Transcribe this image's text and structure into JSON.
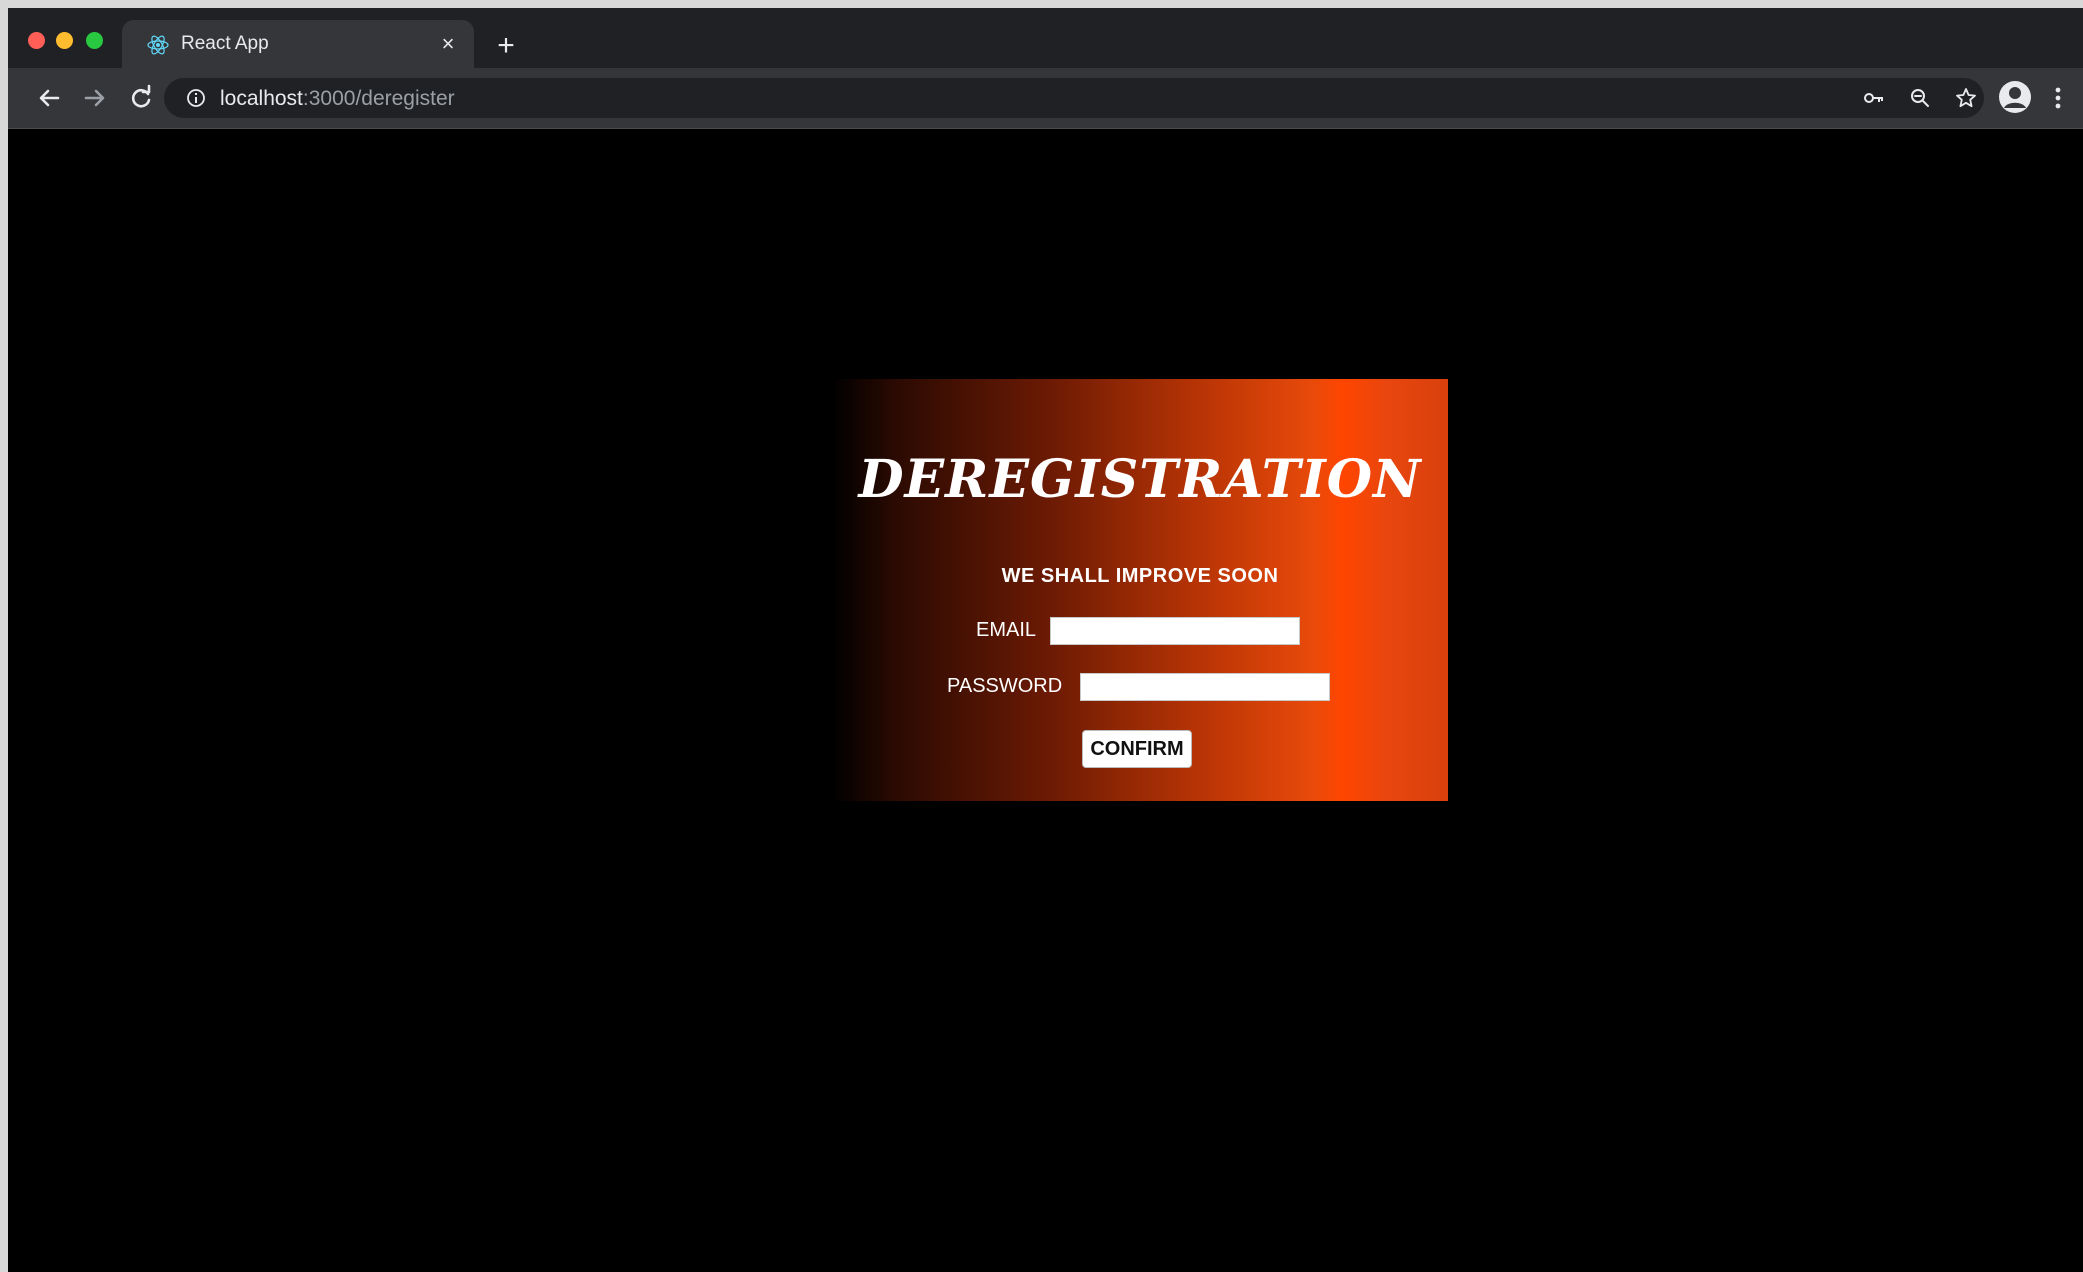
{
  "browser": {
    "tab": {
      "title": "React App",
      "close_glyph": "×",
      "favicon": "react-icon"
    },
    "new_tab_glyph": "+",
    "url": {
      "host": "localhost",
      "path": ":3000/deregister"
    },
    "toolbar_icons": [
      "back-arrow-icon",
      "forward-arrow-icon",
      "reload-icon",
      "info-icon",
      "key-icon",
      "zoom-icon",
      "star-icon",
      "profile-icon",
      "menu-icon"
    ]
  },
  "page": {
    "title": "DEREGISTRATION",
    "subtitle": "WE SHALL IMPROVE SOON",
    "email_label": "EMAIL",
    "email_value": "",
    "password_label": "PASSWORD",
    "password_value": "",
    "confirm_label": "CONFIRM"
  },
  "colors": {
    "page_background": "#000000",
    "card_gradient_start": "#000000",
    "card_gradient_peak": "#ff4500",
    "text": "#ffffff"
  }
}
